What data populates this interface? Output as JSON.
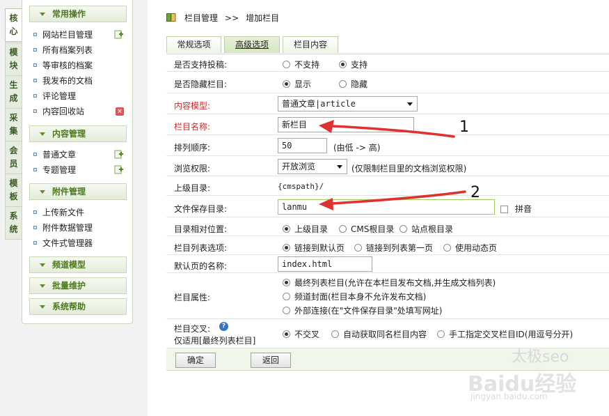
{
  "vtabs": [
    "核心",
    "模块",
    "生成",
    "采集",
    "会员",
    "模板",
    "系统"
  ],
  "menu": {
    "groups": [
      {
        "title": "常用操作",
        "items": [
          "网站栏目管理",
          "所有档案列表",
          "等审核的档案",
          "我发布的文档",
          "评论管理",
          "内容回收站"
        ]
      },
      {
        "title": "内容管理",
        "items": [
          "普通文章",
          "专题管理"
        ]
      },
      {
        "title": "附件管理",
        "items": [
          "上传新文件",
          "附件数据管理",
          "文件式管理器"
        ]
      },
      {
        "title": "频道模型",
        "items": []
      },
      {
        "title": "批量维护",
        "items": []
      },
      {
        "title": "系统帮助",
        "items": []
      }
    ]
  },
  "breadcrumb": {
    "root": "栏目管理",
    "sep": ">>",
    "current": "增加栏目"
  },
  "tabs": [
    "常规选项",
    "高级选项",
    "栏目内容"
  ],
  "form": {
    "submit": {
      "label": "是否支持投稿:",
      "opt1": "不支持",
      "opt2": "支持"
    },
    "hidden": {
      "label": "是否隐藏栏目:",
      "opt1": "显示",
      "opt2": "隐藏"
    },
    "model": {
      "label": "内容模型:",
      "value": "普通文章|article"
    },
    "name": {
      "label": "栏目名称:",
      "value": "新栏目"
    },
    "order": {
      "label": "排列顺序:",
      "value": "50",
      "hint": "(由低 -> 高)"
    },
    "perm": {
      "label": "浏览权限:",
      "value": "开放浏览",
      "hint": "(仅限制栏目里的文档浏览权限)"
    },
    "parent": {
      "label": "上级目录:",
      "value": "{cmspath}/"
    },
    "savedir": {
      "label": "文件保存目录:",
      "value": "lanmu",
      "pinyin": "拼音"
    },
    "relpos": {
      "label": "目录相对位置:",
      "opt1": "上级目录",
      "opt2": "CMS根目录",
      "opt3": "站点根目录"
    },
    "listopt": {
      "label": "栏目列表选项:",
      "opt1": "链接到默认页",
      "opt2": "链接到列表第一页",
      "opt3": "使用动态页"
    },
    "defpage": {
      "label": "默认页的名称:",
      "value": "index.html"
    },
    "attr": {
      "label": "栏目属性:",
      "opt1": "最终列表栏目(允许在本栏目发布文档,并生成文档列表)",
      "opt2": "频道封面(栏目本身不允许发布文档)",
      "opt3": "外部连接(在\"文件保存目录\"处填写网址)"
    },
    "cross": {
      "label": "栏目交叉:",
      "label2": "仅适用[最终列表栏目]",
      "opt1": "不交叉",
      "opt2": "自动获取同名栏目内容",
      "opt3": "手工指定交叉栏目ID(用逗号分开)"
    }
  },
  "buttons": {
    "ok": "确定",
    "back": "返回"
  },
  "annotations": {
    "n1": "1",
    "n2": "2"
  },
  "watermark": {
    "line1": "太极seo",
    "line2": "Baidu经验",
    "line3": "jingyan.baidu.com"
  },
  "colors": {
    "accent_green": "#4a7a1b",
    "label_red": "#c52b2b",
    "arrow_red": "#e03030"
  }
}
